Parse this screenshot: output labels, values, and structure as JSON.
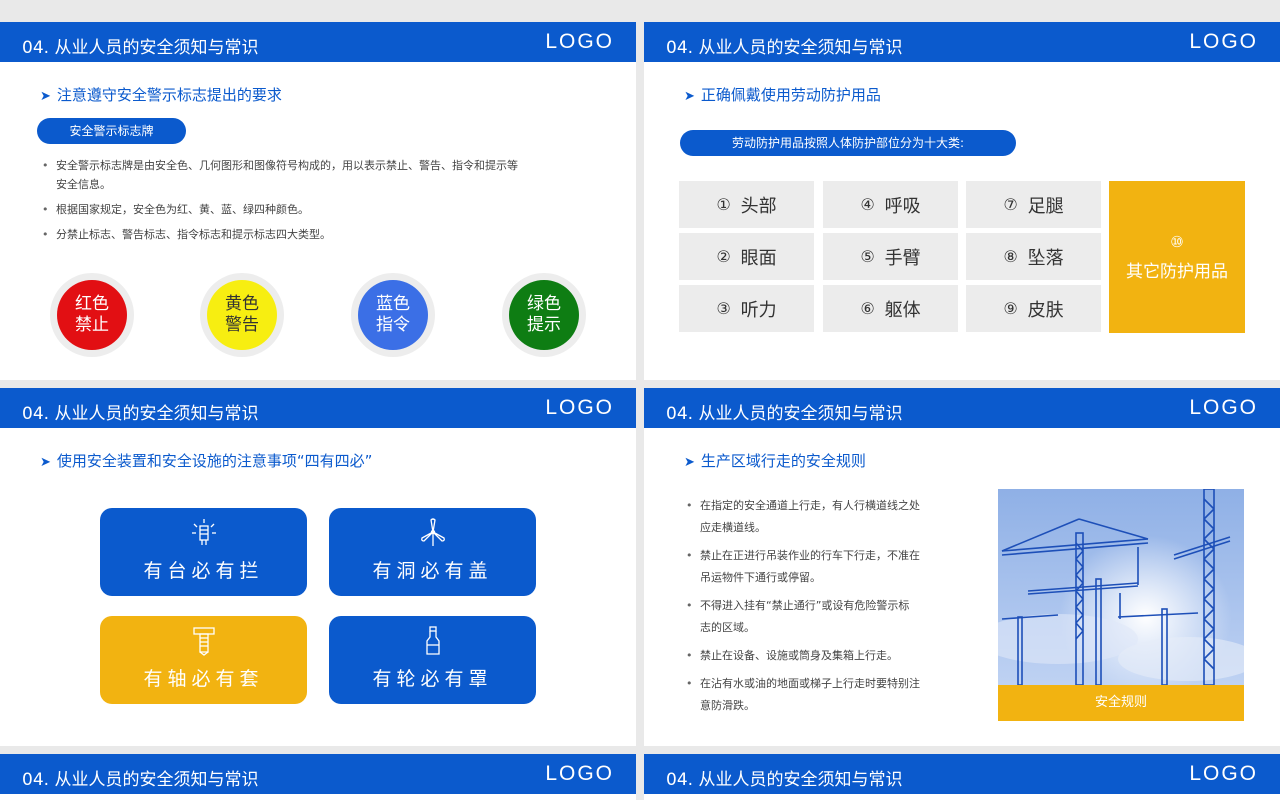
{
  "header": {
    "title": "04. 从业人员的安全须知与常识",
    "logo": "LOGO"
  },
  "slide1": {
    "subtitle": "注意遵守安全警示标志提出的要求",
    "pill": "安全警示标志牌",
    "bullets": [
      "安全警示标志牌是由安全色、几何图形和图像符号构成的，用以表示禁止、警告、指令和提示等",
      "安全信息。",
      "根据国家规定，安全色为红、黄、蓝、绿四种颜色。",
      "分禁止标志、警告标志、指令标志和提示标志四大类型。"
    ],
    "circles": [
      {
        "l1": "红色",
        "l2": "禁止",
        "color": "#e20f13",
        "text": "#ffffff"
      },
      {
        "l1": "黄色",
        "l2": "警告",
        "color": "#f7ee11",
        "text": "#333333"
      },
      {
        "l1": "蓝色",
        "l2": "指令",
        "color": "#3b6fe6",
        "text": "#ffffff"
      },
      {
        "l1": "绿色",
        "l2": "提示",
        "color": "#0e7d13",
        "text": "#ffffff"
      }
    ]
  },
  "slide2": {
    "subtitle": "正确佩戴使用劳动防护用品",
    "pill": "劳动防护用品按照人体防护部位分为十大类:",
    "cells": [
      {
        "num": "①",
        "label": "头部"
      },
      {
        "num": "④",
        "label": "呼吸"
      },
      {
        "num": "⑦",
        "label": "足腿"
      },
      {
        "num": "②",
        "label": "眼面"
      },
      {
        "num": "⑤",
        "label": "手臂"
      },
      {
        "num": "⑧",
        "label": "坠落"
      },
      {
        "num": "③",
        "label": "听力"
      },
      {
        "num": "⑥",
        "label": "躯体"
      },
      {
        "num": "⑨",
        "label": "皮肤"
      }
    ],
    "big": {
      "num": "⑩",
      "label": "其它防护用品"
    }
  },
  "slide3": {
    "subtitle": "使用安全装置和安全设施的注意事项“四有四必”",
    "cards": [
      {
        "label": "有台必有拦",
        "icon": "lamp-icon"
      },
      {
        "label": "有洞必有盖",
        "icon": "fan-icon"
      },
      {
        "label": "有轴必有套",
        "icon": "bolt-icon"
      },
      {
        "label": "有轮必有罩",
        "icon": "bottle-icon"
      }
    ],
    "colors": {
      "blue": "#0b5acd",
      "yellow": "#f2b311"
    }
  },
  "slide4": {
    "subtitle": "生产区域行走的安全规则",
    "bullets": [
      {
        "l1": "在指定的安全通道上行走，有人行横道线之处",
        "l2": "应走横道线。"
      },
      {
        "l1": "禁止在正进行吊装作业的行车下行走，不准在",
        "l2": "吊运物件下通行或停留。"
      },
      {
        "l1": "不得进入挂有“禁止通行”或设有危险警示标",
        "l2": "志的区域。"
      },
      {
        "l1": "禁止在设备、设施或筒身及集箱上行走。",
        "l2": ""
      },
      {
        "l1": "在沾有水或油的地面或梯子上行走时要特别注",
        "l2": "意防滑跌。"
      }
    ],
    "photo_caption": "安全规则"
  }
}
